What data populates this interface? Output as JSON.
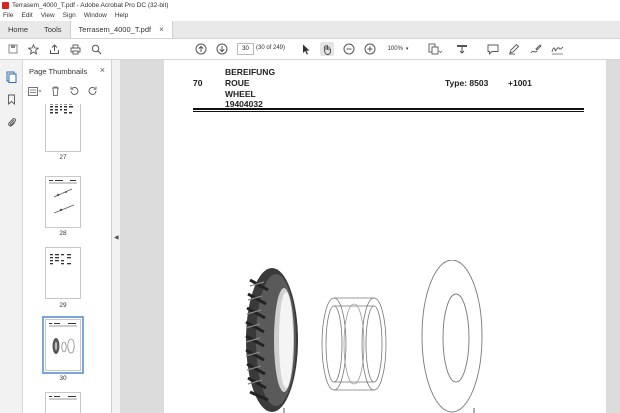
{
  "window": {
    "title": "Terrasem_4000_T.pdf - Adobe Acrobat Pro DC (32-bit)"
  },
  "menu": [
    "File",
    "Edit",
    "View",
    "Sign",
    "Window",
    "Help"
  ],
  "tabs": {
    "home": "Home",
    "tools": "Tools",
    "document": "Terrasem_4000_T.pdf",
    "close": "×"
  },
  "toolbar": {
    "page_current": "30",
    "page_count": "(30 of 249)",
    "zoom": "100%"
  },
  "panel": {
    "title": "Page Thumbnails",
    "close": "×",
    "thumbnails": [
      {
        "label": "27",
        "selected": false
      },
      {
        "label": "28",
        "selected": false
      },
      {
        "label": "29",
        "selected": false
      },
      {
        "label": "30",
        "selected": true
      }
    ]
  },
  "document": {
    "section_number": "70",
    "title_lines": [
      "BEREIFUNG",
      "ROUE",
      "WHEEL",
      "19404032"
    ],
    "type_label": "Type: 8503",
    "code": "+1001"
  },
  "colors": {
    "accent": "#d9261c",
    "selection": "#7aa7d6",
    "background": "#dcdcdc"
  },
  "icons": [
    "save-icon",
    "bookmark-star-icon",
    "upload-icon",
    "print-icon",
    "search-icon",
    "page-up-icon",
    "page-down-icon",
    "select-arrow-icon",
    "hand-icon",
    "zoom-out-icon",
    "zoom-in-icon",
    "page-layout-icon",
    "scroll-icon",
    "comment-icon",
    "highlight-icon",
    "draw-icon",
    "sign-icon",
    "thumbnails-icon",
    "bookmarks-icon",
    "attachments-icon",
    "options-icon",
    "delete-icon",
    "rotate-ccw-icon",
    "rotate-cw-icon"
  ]
}
